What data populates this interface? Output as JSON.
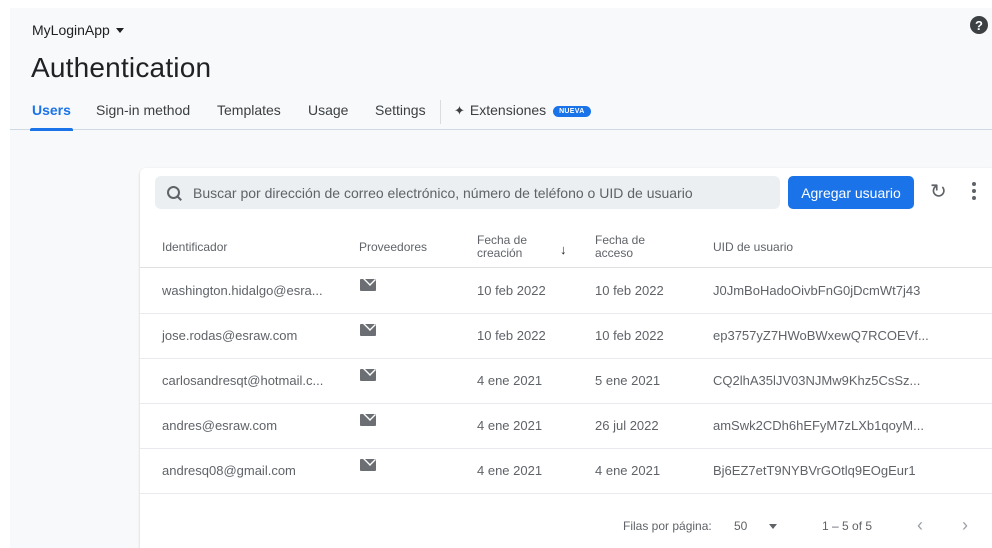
{
  "project": {
    "name": "MyLoginApp"
  },
  "help": {
    "label": "?"
  },
  "page": {
    "title": "Authentication"
  },
  "tabs": [
    {
      "label": "Users",
      "active": true
    },
    {
      "label": "Sign-in method",
      "active": false
    },
    {
      "label": "Templates",
      "active": false
    },
    {
      "label": "Usage",
      "active": false
    },
    {
      "label": "Settings",
      "active": false
    },
    {
      "label": "Extensiones",
      "active": false,
      "badge": "NUEVA"
    }
  ],
  "toolbar": {
    "search_placeholder": "Buscar por dirección de correo electrónico, número de teléfono o UID de usuario",
    "add_user_label": "Agregar usuario",
    "refresh_icon": "↻"
  },
  "table": {
    "columns": {
      "identifier": "Identificador",
      "providers": "Proveedores",
      "created_line1": "Fecha de",
      "created_line2": "creación",
      "signed_in_line1": "Fecha de",
      "signed_in_line2": "acceso",
      "uid": "UID de usuario"
    },
    "sort_icon": "↓",
    "rows": [
      {
        "identifier": "washington.hidalgo@esra...",
        "provider": "email-icon",
        "created": "10 feb 2022",
        "signed_in": "10 feb 2022",
        "uid": "J0JmBoHadoOivbFnG0jDcmWt7j43"
      },
      {
        "identifier": "jose.rodas@esraw.com",
        "provider": "email-icon",
        "created": "10 feb 2022",
        "signed_in": "10 feb 2022",
        "uid": "ep3757yZ7HWoBWxewQ7RCOEVf..."
      },
      {
        "identifier": "carlosandresqt@hotmail.c...",
        "provider": "email-icon",
        "created": "4 ene 2021",
        "signed_in": "5 ene 2021",
        "uid": "CQ2lhA35lJV03NJMw9Khz5CsSz..."
      },
      {
        "identifier": "andres@esraw.com",
        "provider": "email-icon",
        "created": "4 ene 2021",
        "signed_in": "26 jul 2022",
        "uid": "amSwk2CDh6hEFyM7zLXb1qoyM..."
      },
      {
        "identifier": "andresq08@gmail.com",
        "provider": "email-icon",
        "created": "4 ene 2021",
        "signed_in": "4 ene 2021",
        "uid": "Bj6EZ7etT9NYBVrGOtlq9EOgEur1"
      }
    ]
  },
  "pagination": {
    "rows_per_page_label": "Filas por página:",
    "rows_per_page": "50",
    "range": "1 – 5 of 5",
    "prev_icon": "‹",
    "next_icon": "›"
  },
  "colors": {
    "accent": "#1a73e8",
    "background": "#f8f9fa"
  }
}
